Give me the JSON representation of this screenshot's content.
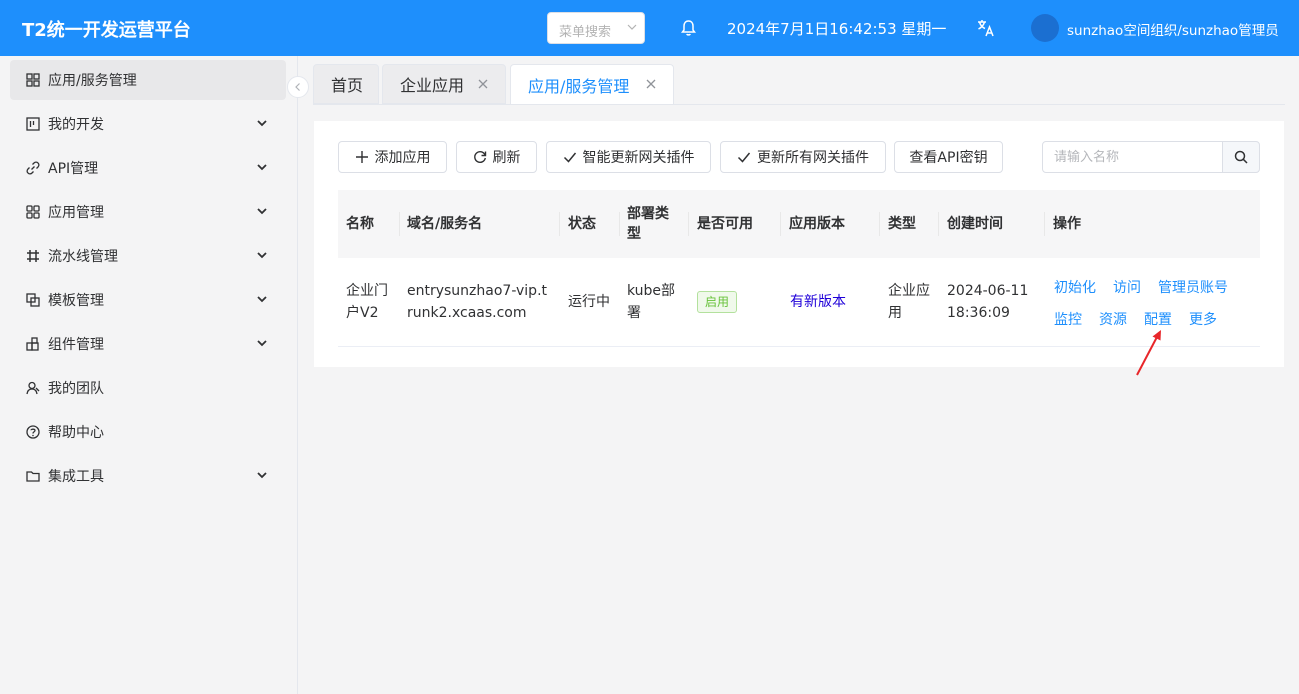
{
  "header": {
    "brand": "T2统一开发运营平台",
    "menu_search_placeholder": "菜单搜索",
    "datetime": "2024年7月1日16:42:53 星期一",
    "user": "sunzhao空间组织/sunzhao管理员"
  },
  "sidebar": {
    "items": [
      {
        "label": "应用/服务管理",
        "icon": "grid-icon",
        "expandable": false,
        "active": true
      },
      {
        "label": "我的开发",
        "icon": "board-icon",
        "expandable": true
      },
      {
        "label": "API管理",
        "icon": "link-icon",
        "expandable": true
      },
      {
        "label": "应用管理",
        "icon": "apps-icon",
        "expandable": true
      },
      {
        "label": "流水线管理",
        "icon": "pipeline-icon",
        "expandable": true
      },
      {
        "label": "模板管理",
        "icon": "template-icon",
        "expandable": true
      },
      {
        "label": "组件管理",
        "icon": "component-icon",
        "expandable": true
      },
      {
        "label": "我的团队",
        "icon": "team-icon",
        "expandable": false
      },
      {
        "label": "帮助中心",
        "icon": "help-icon",
        "expandable": false
      },
      {
        "label": "集成工具",
        "icon": "folder-icon",
        "expandable": true
      }
    ]
  },
  "tabs": [
    {
      "label": "首页",
      "closable": false
    },
    {
      "label": "企业应用",
      "closable": true
    },
    {
      "label": "应用/服务管理",
      "closable": true,
      "active": true
    }
  ],
  "toolbar": {
    "add": "添加应用",
    "refresh": "刷新",
    "smart_update": "智能更新网关插件",
    "update_all": "更新所有网关插件",
    "api_key": "查看API密钥",
    "search_placeholder": "请输入名称"
  },
  "table": {
    "headers": [
      "名称",
      "域名/服务名",
      "状态",
      "部署类型",
      "是否可用",
      "应用版本",
      "类型",
      "创建时间",
      "操作"
    ],
    "rows": [
      {
        "name": "企业门户V2",
        "domain": "entrysunzhao7-vip.trunk2.xcaas.com",
        "status": "运行中",
        "deploy_type": "kube部署",
        "available": "启用",
        "version": "有新版本",
        "type": "企业应用",
        "created": "2024-06-11 18:36:09",
        "actions": [
          "初始化",
          "访问",
          "管理员账号",
          "监控",
          "资源",
          "配置",
          "更多"
        ]
      }
    ]
  },
  "colors": {
    "primary": "#1e8ffc",
    "header_bg": "#1e8ffc",
    "success": "#67c23a",
    "annotation": "#e8262a"
  }
}
